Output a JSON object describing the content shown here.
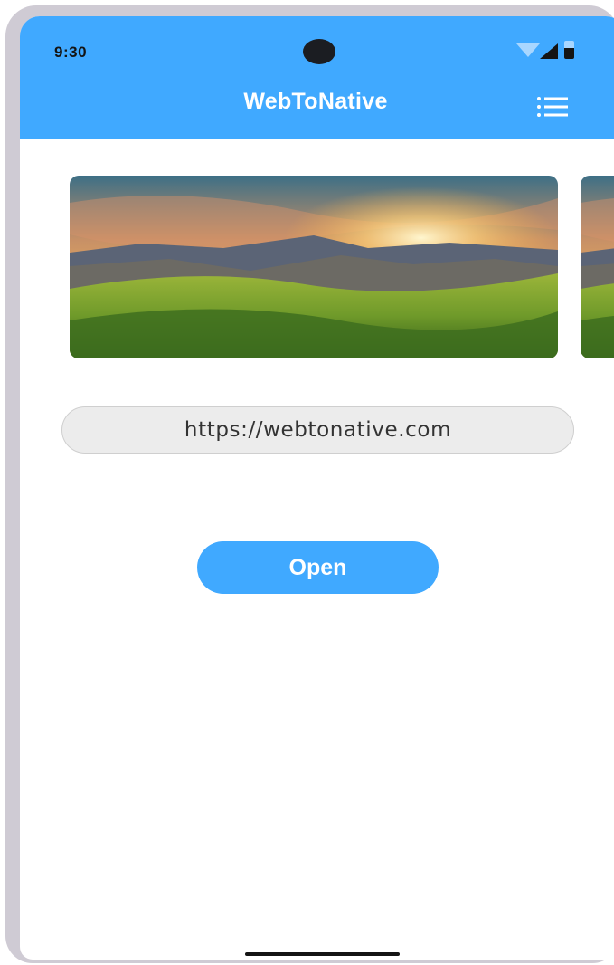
{
  "status_bar": {
    "time": "9:30",
    "icons": [
      "wifi-icon",
      "cell-signal-icon",
      "battery-icon"
    ]
  },
  "app_bar": {
    "title": "WebToNative",
    "menu_icon": "list-menu-icon"
  },
  "carousel": {
    "images": [
      "sunset-mountain-meadow",
      "sunset-mountain-meadow"
    ]
  },
  "url_field": {
    "value": "https://webtonative.com"
  },
  "open_button": {
    "label": "Open"
  },
  "colors": {
    "primary": "#40a9ff",
    "url_field_bg": "#ececec",
    "frame": "#cfcbd4"
  }
}
